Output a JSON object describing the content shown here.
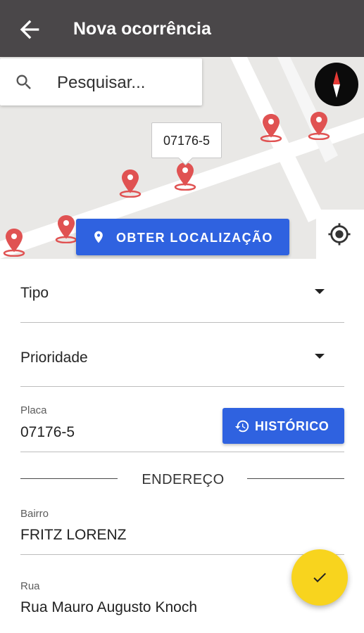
{
  "appbar": {
    "title": "Nova ocorrência",
    "back_icon": "arrow-left-icon"
  },
  "map": {
    "search_placeholder": "Pesquisar...",
    "marker_callout": "07176-5",
    "get_location_label": "OBTER LOCALIZAÇÃO",
    "compass_icon": "compass-icon",
    "my_location_icon": "my-location-icon",
    "marker_color": "#e05252"
  },
  "form": {
    "tipo_label": "Tipo",
    "prioridade_label": "Prioridade",
    "placa_label": "Placa",
    "placa_value": "07176-5",
    "historico_label": "HISTÓRICO",
    "section_title": "ENDEREÇO",
    "bairro_label": "Bairro",
    "bairro_value": "FRITZ LORENZ",
    "rua_label": "Rua",
    "rua_value": "Rua Mauro Augusto Knoch"
  },
  "colors": {
    "appbar": "#4a4749",
    "primary_button": "#2f62e0",
    "fab": "#f8d41e"
  }
}
